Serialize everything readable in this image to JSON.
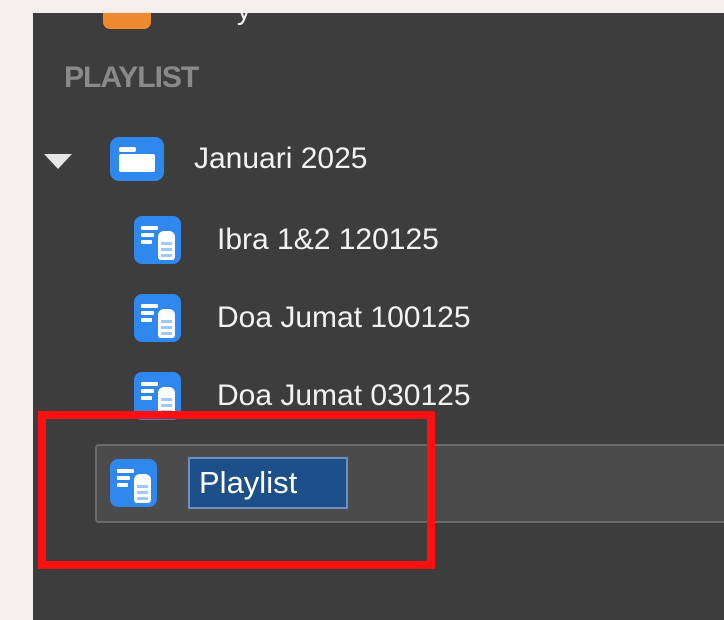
{
  "sidebar": {
    "section_header": "PLAYLIST",
    "folder": {
      "label": "Januari 2025",
      "icon": "folder-icon",
      "expanded": true
    },
    "items": [
      {
        "label": "Ibra 1&2 120125",
        "icon": "playlist-icon"
      },
      {
        "label": "Doa Jumat 100125",
        "icon": "playlist-icon"
      },
      {
        "label": "Doa Jumat 030125",
        "icon": "playlist-icon"
      }
    ],
    "rename": {
      "value": "Playlist",
      "icon": "playlist-icon"
    },
    "partial_top_text": "y"
  },
  "colors": {
    "panel_background": "#3d3d3d",
    "icon_blue": "#2f88ee",
    "selection_blue": "#1d4f88",
    "highlight_red": "#ff1010",
    "header_gray": "#8a8a8a"
  }
}
